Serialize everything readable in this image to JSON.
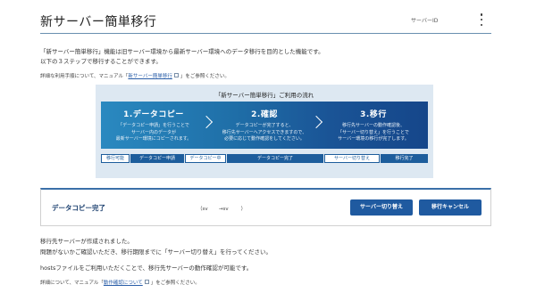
{
  "header": {
    "title": "新サーバー簡単移行",
    "server_id_label": "サーバーID"
  },
  "intro": {
    "line1": "「新サーバー簡単移行」機能は旧サーバー環境から最新サーバー環境へのデータ移行を目的とした機能です。",
    "line2": "以下の３ステップで移行することができます。"
  },
  "manual_note": {
    "prefix": "詳細な利用手順について、マニュアル「",
    "link": "新サーバー簡単移行",
    "suffix": "」をご参照ください。"
  },
  "flow": {
    "title": "「新サーバー簡単移行」ご利用の流れ",
    "steps": [
      {
        "title": "1.データコピー",
        "desc": "「データコピー申請」を行うことで\nサーバー内のデータが\n最新サーバー環境にコピーされます。"
      },
      {
        "title": "2.確認",
        "desc": "データコピーが完了すると、\n移行先サーバーへアクセスできますので、\n必要に応じて動作確認をしてください。"
      },
      {
        "title": "3.移行",
        "desc": "移行先サーバーの動作確認後、\n「サーバー切り替え」を行うことで\nサーバー環境の移行が完了します。"
      }
    ],
    "bar": [
      "移行可能",
      "データコピー申請",
      "データコピー中",
      "データコピー完了",
      "サーバー切り替え",
      "移行完了"
    ]
  },
  "status": {
    "label": "データコピー完了",
    "server_range": "（sv       →sv        ）",
    "switch_button": "サーバー切り替え",
    "cancel_button": "移行キャンセル"
  },
  "after": {
    "line1": "移行先サーバーが作成されました。",
    "line2": "問題がないかご確認いただき、移行期限までに「サーバー切り替え」を行ってください。",
    "line3": "hostsファイルをご利用いただくことで、移行先サーバーの動作確認が可能です。",
    "manual_prefix": "詳細について、マニュアル「",
    "manual_link": "動作確認について",
    "manual_suffix": "」をご参照ください。"
  }
}
